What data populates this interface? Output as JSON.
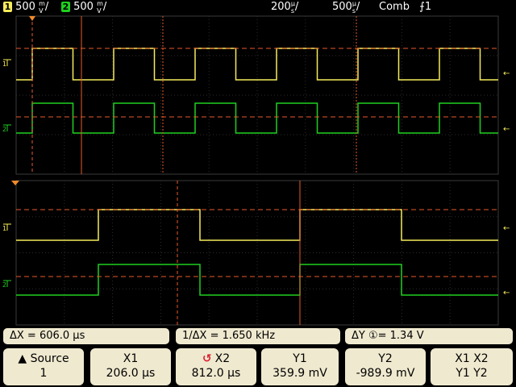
{
  "topbar": {
    "ch1_badge": "1",
    "ch1_scale_value": "500",
    "ch1_scale_unit_top": "m",
    "ch1_scale_unit_bottom": "V",
    "ch2_badge": "2",
    "ch2_scale_value": "500",
    "ch2_scale_unit_top": "m",
    "ch2_scale_unit_bottom": "V",
    "timebase_value": "200",
    "timebase_unit_top": "µ",
    "timebase_unit_bottom": "s",
    "zoom_timebase_value": "500",
    "zoom_timebase_unit_top": "µ",
    "zoom_timebase_unit_bottom": "s",
    "trigger_mode": "Comb",
    "trigger_slope_icon": "rising-edge-icon",
    "trigger_source": "1"
  },
  "colors": {
    "ch1": "#f5ec5a",
    "ch2": "#1fd020",
    "cursor": "#e85a2a",
    "trigger_marker": "#f08a2a"
  },
  "measurements": {
    "delta_x": "ΔX = 606.0 µs",
    "inverse_delta_x": "1/ΔX =  1.650 kHz",
    "delta_y": "ΔY ①=  1.34  V"
  },
  "softkeys": {
    "source_label": "Source",
    "source_value": "1",
    "x1_label": "X1",
    "x1_value": "206.0 µs",
    "x2_label": "X2",
    "x2_value": "812.0 µs",
    "y1_label": "Y1",
    "y1_value": "359.9 mV",
    "y2_label": "Y2",
    "y2_value": "-989.9 mV",
    "xy_label_top": "X1  X2",
    "xy_label_bottom": "Y1  Y2"
  }
}
